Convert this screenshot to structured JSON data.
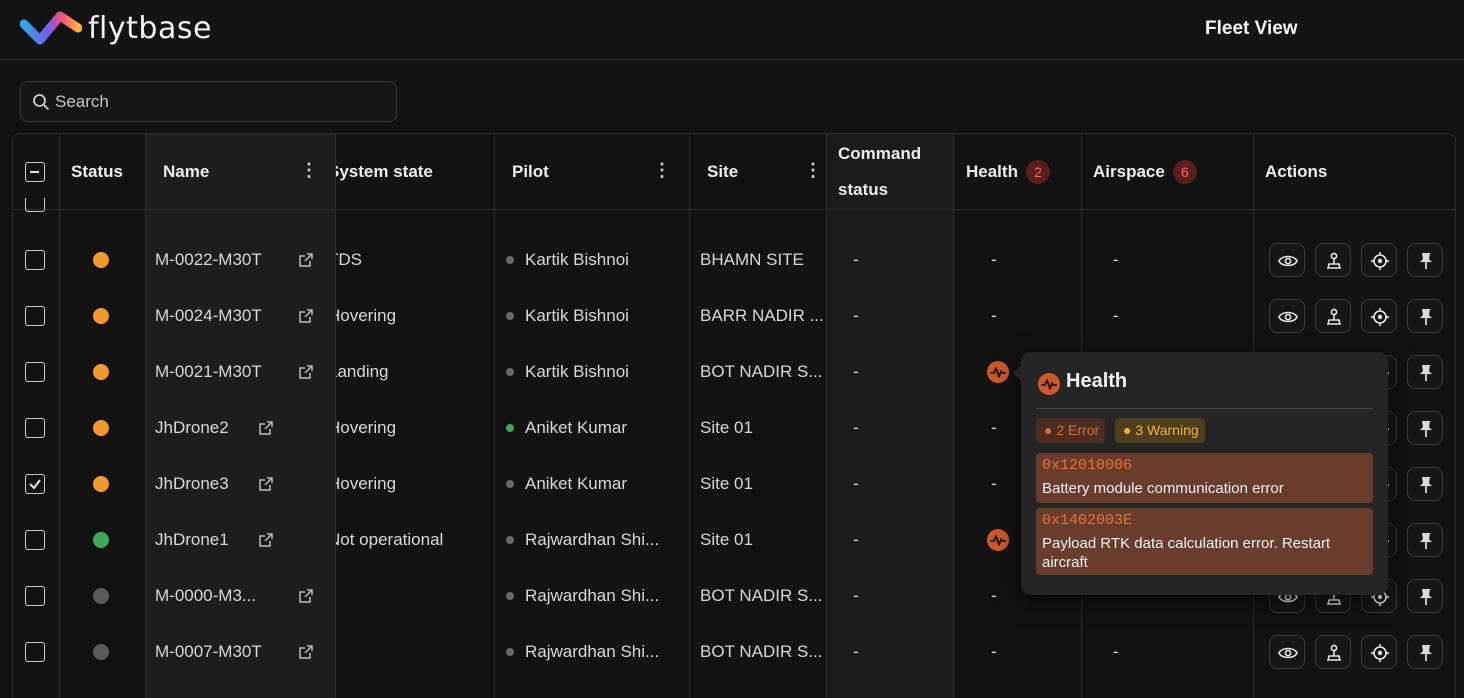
{
  "header": {
    "brand": "flytbase",
    "title": "Fleet View"
  },
  "search": {
    "placeholder": "Search"
  },
  "table": {
    "columns": {
      "status": "Status",
      "name": "Name",
      "system_state": "System state",
      "pilot": "Pilot",
      "site": "Site",
      "command_status_line1": "Command",
      "command_status_line2": "status",
      "health": "Health",
      "health_count": "2",
      "airspace": "Airspace",
      "airspace_count": "6",
      "actions": "Actions"
    },
    "rows": [
      {
        "checked": false,
        "status_color": "#f0972e",
        "name": "M-0022-M30T",
        "system_state": "TDS",
        "pilot": "Kartik Bishnoi",
        "pilot_online": false,
        "site": "BHAMN SITE",
        "command_status": "-",
        "health": "-",
        "airspace": "-"
      },
      {
        "checked": false,
        "status_color": "#f0972e",
        "name": "M-0024-M30T",
        "system_state": "Hovering",
        "pilot": "Kartik Bishnoi",
        "pilot_online": false,
        "site": "BARR NADIR ...",
        "command_status": "-",
        "health": "-",
        "airspace": "-"
      },
      {
        "checked": false,
        "status_color": "#f0972e",
        "name": "M-0021-M30T",
        "system_state": "Landing",
        "pilot": "Kartik Bishnoi",
        "pilot_online": false,
        "site": "BOT NADIR S...",
        "command_status": "-",
        "health": "icon",
        "airspace": ""
      },
      {
        "checked": false,
        "status_color": "#f0972e",
        "name": "JhDrone2",
        "system_state": "Hovering",
        "pilot": "Aniket Kumar",
        "pilot_online": true,
        "site": "Site 01",
        "command_status": "-",
        "health": "-",
        "airspace": ""
      },
      {
        "checked": true,
        "status_color": "#f0972e",
        "name": "JhDrone3",
        "system_state": "Hovering",
        "pilot": "Aniket Kumar",
        "pilot_online": false,
        "site": "Site 01",
        "command_status": "-",
        "health": "-",
        "airspace": ""
      },
      {
        "checked": false,
        "status_color": "#3fa65b",
        "name": "JhDrone1",
        "system_state": "Not operational",
        "pilot": "Rajwardhan Shi...",
        "pilot_online": false,
        "site": "Site 01",
        "command_status": "-",
        "health": "icon",
        "airspace": ""
      },
      {
        "checked": false,
        "status_color": "#5a5a5a",
        "name": "M-0000-M3...",
        "system_state": "",
        "pilot": "Rajwardhan Shi...",
        "pilot_online": false,
        "site": "BOT NADIR S...",
        "command_status": "-",
        "health": "-",
        "airspace": ""
      },
      {
        "checked": false,
        "status_color": "#5a5a5a",
        "name": "M-0007-M30T",
        "system_state": "",
        "pilot": "Rajwardhan Shi...",
        "pilot_online": false,
        "site": "BOT NADIR S...",
        "command_status": "-",
        "health": "-",
        "airspace": "-"
      }
    ]
  },
  "health_popover": {
    "title": "Health",
    "error_chip": "2 Error",
    "warning_chip": "3 Warning",
    "errors": [
      {
        "code": "0x12010006",
        "message": "Battery module communication error"
      },
      {
        "code": "0x1402003E",
        "message": "Payload RTK data calculation error. Restart aircraft"
      }
    ]
  },
  "colors": {
    "accent": "#d0572a",
    "status_orange": "#f0972e",
    "status_green": "#3fa65b",
    "status_offline": "#5a5a5a",
    "error_badge": "#ff6b5b"
  },
  "icons": {
    "view": "eye-icon",
    "land": "land-icon",
    "locate": "target-icon",
    "pin": "pin-icon"
  }
}
